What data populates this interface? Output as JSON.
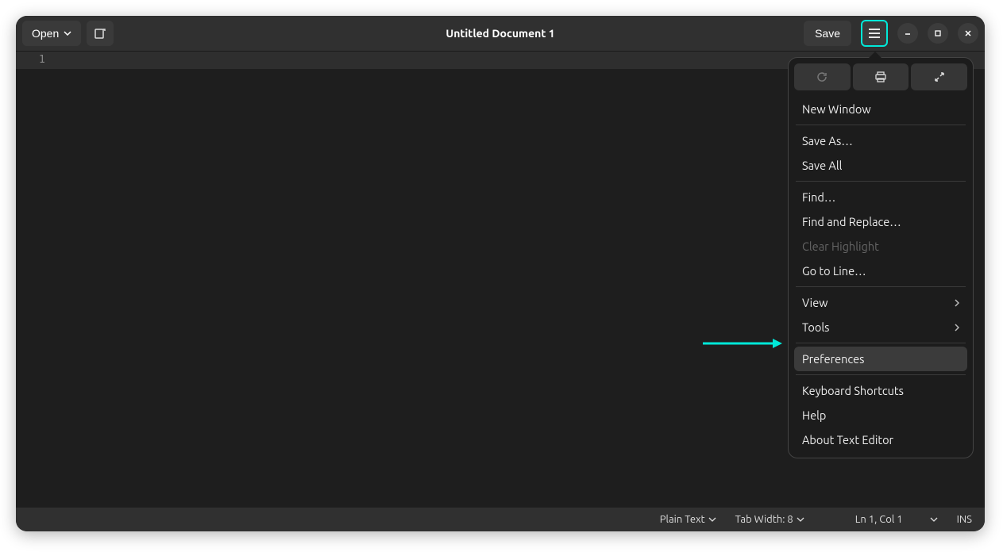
{
  "header": {
    "open_label": "Open",
    "title": "Untitled Document 1",
    "save_label": "Save"
  },
  "editor": {
    "line_number": "1"
  },
  "menu": {
    "new_window": "New Window",
    "save_as": "Save As…",
    "save_all": "Save All",
    "find": "Find…",
    "find_replace": "Find and Replace…",
    "clear_highlight": "Clear Highlight",
    "go_to_line": "Go to Line…",
    "view": "View",
    "tools": "Tools",
    "preferences": "Preferences",
    "keyboard_shortcuts": "Keyboard Shortcuts",
    "help": "Help",
    "about": "About Text Editor"
  },
  "statusbar": {
    "language": "Plain Text",
    "tab_width": "Tab Width: 8",
    "position": "Ln 1, Col 1",
    "insert_mode": "INS"
  },
  "annotation": {
    "color": "#00e8d8"
  }
}
